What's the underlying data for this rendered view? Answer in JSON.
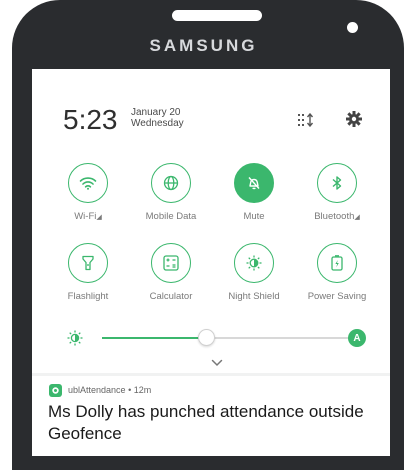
{
  "device": {
    "brand": "SAMSUNG"
  },
  "status": {
    "time": "5:23",
    "date": "January 20",
    "weekday": "Wednesday"
  },
  "header_icons": [
    "edit-order-icon",
    "gear-icon"
  ],
  "quick_settings": [
    {
      "label": "Wi-Fi",
      "icon": "wifi-icon",
      "active": false,
      "has_arrow": true
    },
    {
      "label": "Mobile Data",
      "icon": "globe-icon",
      "active": false,
      "has_arrow": false
    },
    {
      "label": "Mute",
      "icon": "bell-off-icon",
      "active": true,
      "has_arrow": false
    },
    {
      "label": "Bluetooth",
      "icon": "bluetooth-icon",
      "active": false,
      "has_arrow": true
    },
    {
      "label": "Flashlight",
      "icon": "flashlight-icon",
      "active": false,
      "has_arrow": false
    },
    {
      "label": "Calculator",
      "icon": "calculator-icon",
      "active": false,
      "has_arrow": false
    },
    {
      "label": "Night Shield",
      "icon": "night-shield-icon",
      "active": false,
      "has_arrow": false
    },
    {
      "label": "Power Saving",
      "icon": "battery-icon",
      "active": false,
      "has_arrow": false
    }
  ],
  "brightness": {
    "level_fraction": 0.4,
    "auto_label": "A"
  },
  "notification": {
    "app_name": "ublAttendance",
    "separator": "•",
    "age": "12m",
    "message": "Ms Dolly has punched attendance outside Geofence"
  },
  "colors": {
    "accent": "#3bb76d",
    "bezel": "#2a2c2f",
    "text": "#2f2f2f",
    "label": "#7a7a7a"
  }
}
